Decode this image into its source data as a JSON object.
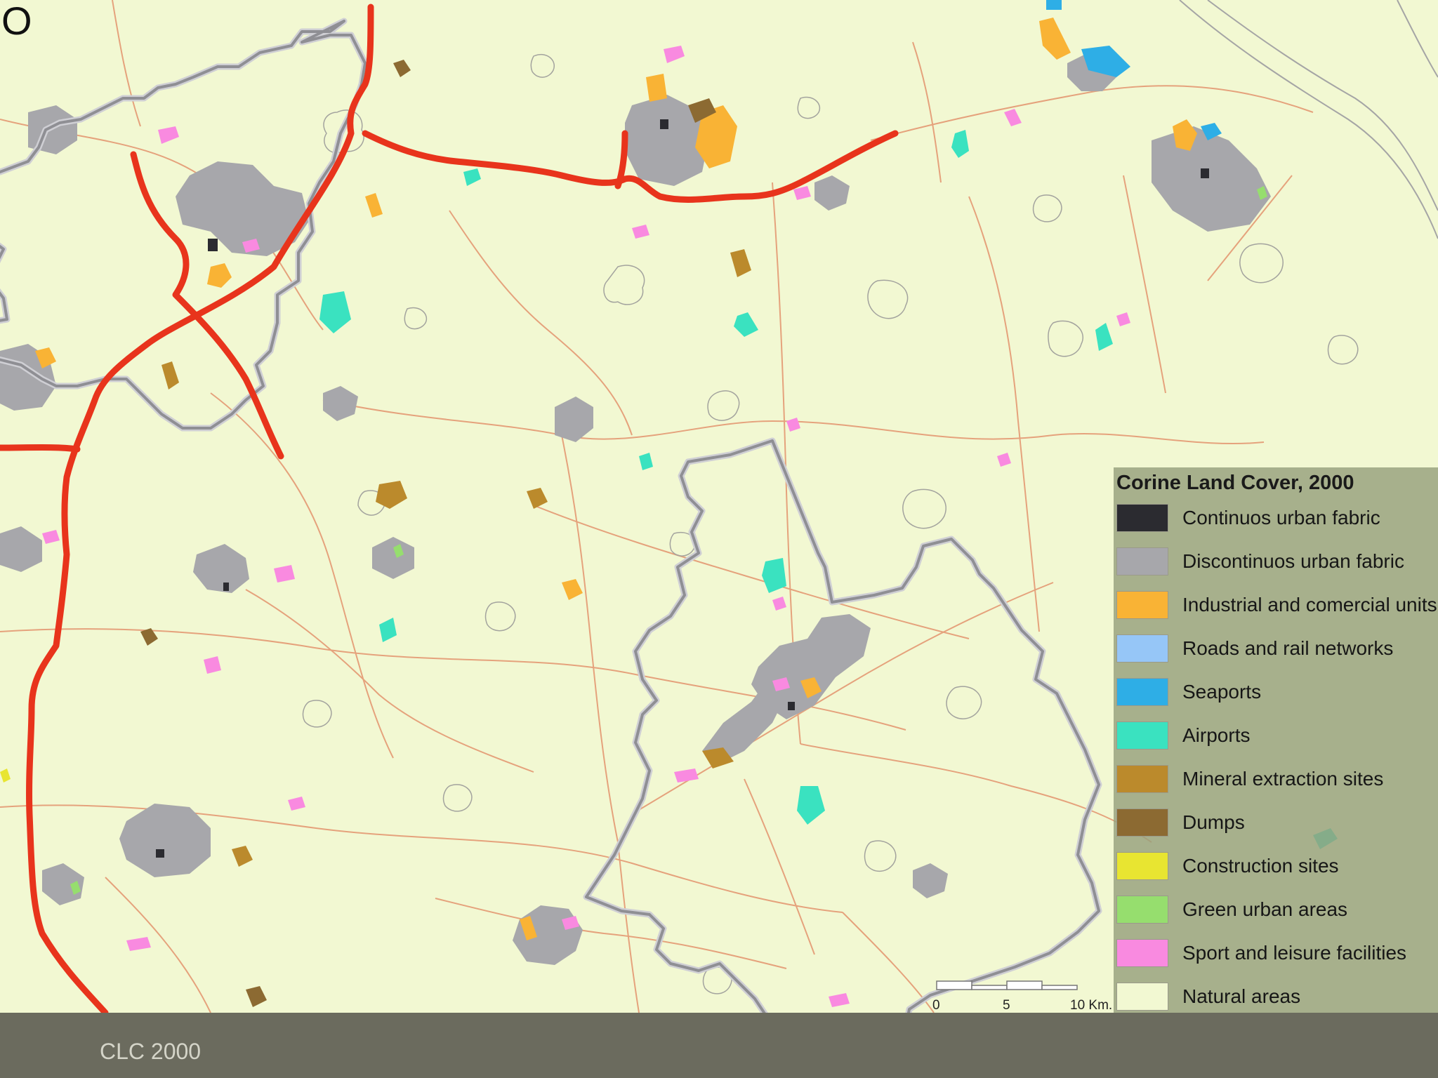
{
  "map": {
    "corner_label": "O",
    "colors": {
      "background": "#f2f8d2",
      "highway": "#e8341c",
      "minor_road": "#e5a27c",
      "boundary": "#8f8f94",
      "boundary_halo": "#cfcfd4",
      "lake_outline": "#9a9a9a"
    }
  },
  "legend": {
    "title": "Corine Land Cover, 2000",
    "items": [
      {
        "label": "Continuos urban fabric",
        "color": "#2b2b30"
      },
      {
        "label": "Discontinuos urban fabric",
        "color": "#a7a7ab"
      },
      {
        "label": "Industrial and comercial units",
        "color": "#f9b335"
      },
      {
        "label": "Roads and rail networks",
        "color": "#96c6f7"
      },
      {
        "label": "Seaports",
        "color": "#2eaee6"
      },
      {
        "label": "Airports",
        "color": "#3ae2c0"
      },
      {
        "label": "Mineral extraction sites",
        "color": "#bb8a2c"
      },
      {
        "label": "Dumps",
        "color": "#8c6a32"
      },
      {
        "label": "Construction sites",
        "color": "#e8e531"
      },
      {
        "label": "Green urban areas",
        "color": "#96de6e"
      },
      {
        "label": "Sport and leisure facilities",
        "color": "#f98ae0"
      },
      {
        "label": "Natural areas",
        "color": "#f2f8d2"
      }
    ]
  },
  "scale": {
    "labels": [
      "0",
      "5",
      "10 Km."
    ]
  },
  "footer": {
    "caption": "CLC 2000"
  }
}
